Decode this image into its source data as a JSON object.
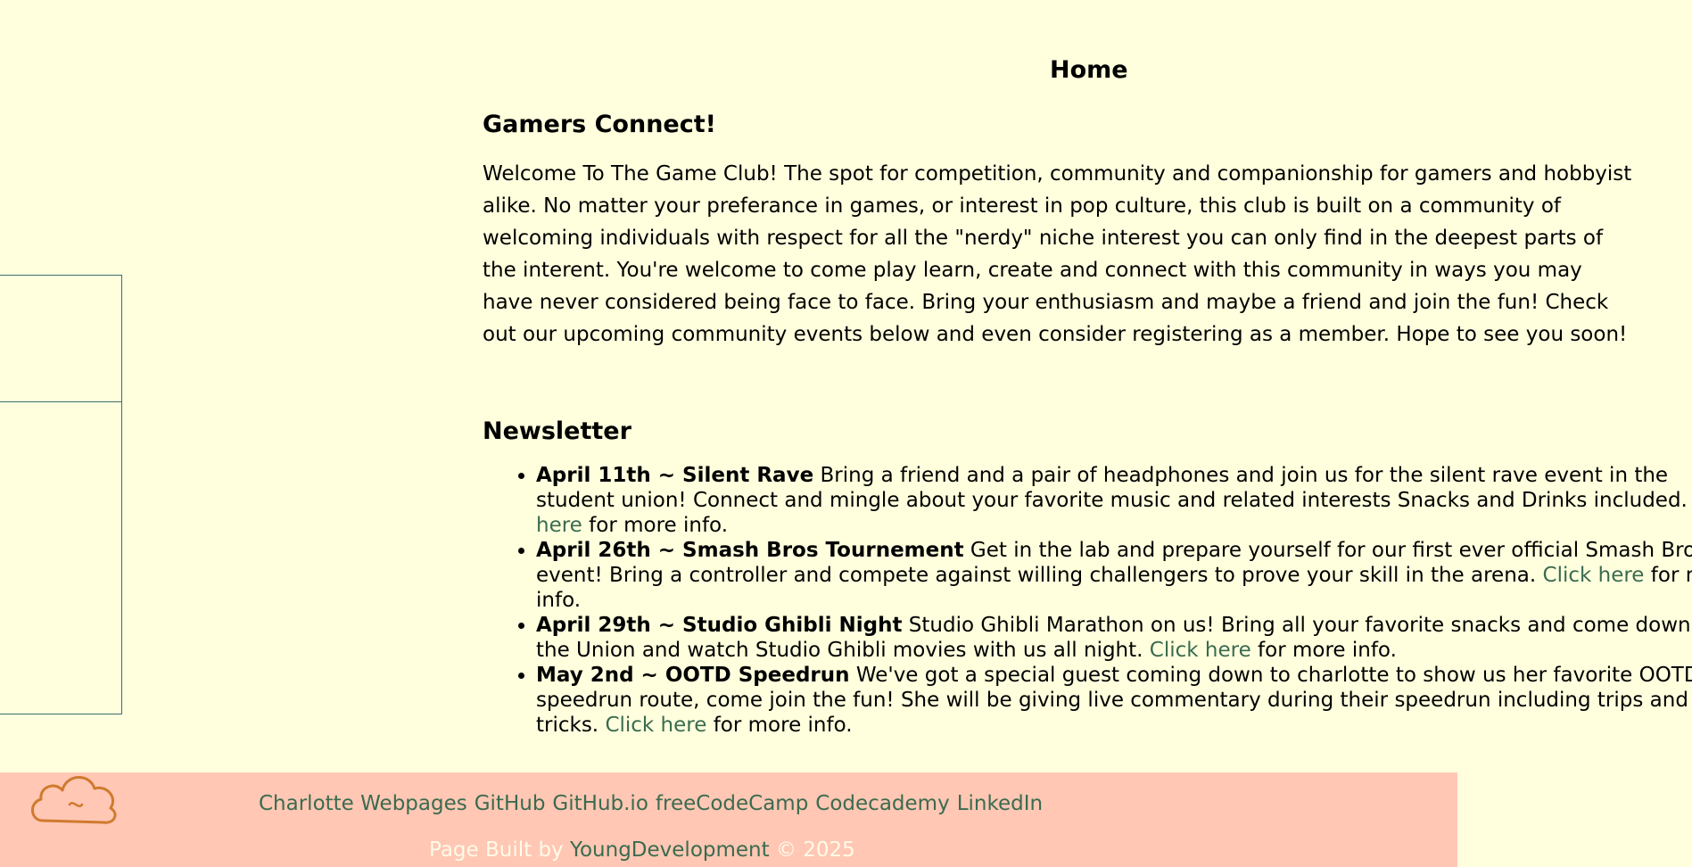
{
  "header": {
    "title": "Home"
  },
  "intro": {
    "title": "Gamers Connect!",
    "body": "Welcome To The Game Club! The spot for competition, community and companionship for gamers and hobbyist alike. No matter your preferance in games, or interest in pop culture, this club is built on a community of welcoming individuals with respect for all the \"nerdy\" niche interest you can only find in the deepest parts of the interent. You're welcome to come play learn, create and connect with this community in ways you may have never considered being face to face. Bring your enthusiasm and maybe a friend and join the fun! Check out our upcoming community events below and even consider registering as a member. Hope to see you soon!"
  },
  "newsletter": {
    "title": "Newsletter",
    "events": [
      {
        "heading": "April 11th ~ Silent Rave",
        "text": " Bring a friend and a pair of headphones and join us for the silent rave event in the student union! Connect and mingle about your favorite music and related interests Snacks and Drinks included. ",
        "link": "Click here",
        "suffix": " for more info."
      },
      {
        "heading": "April 26th ~ Smash Bros Tournement",
        "text": " Get in the lab and prepare yourself for our first ever official Smash Bros event! Bring a controller and compete against willing challengers to prove your skill in the arena. ",
        "link": "Click here",
        "suffix": " for more info."
      },
      {
        "heading": "April 29th ~ Studio Ghibli Night",
        "text": " Studio Ghibli Marathon on us! Bring all your favorite snacks and come down to the Union and watch Studio Ghibli movies with us all night. ",
        "link": "Click here",
        "suffix": " for more info."
      },
      {
        "heading": "May 2nd ~ OOTD Speedrun",
        "text": " We've got a special guest coming down to charlotte to show us her favorite OOTD speedrun route, come join the fun! She will be giving live commentary during their speedrun including trips and tricks. ",
        "link": "Click here",
        "suffix": " for more info."
      }
    ]
  },
  "footer": {
    "logo_icon": "cloud-icon",
    "links": [
      "Charlotte Webpages",
      "GitHub",
      "GitHub.io",
      "freeCodeCamp",
      "Codecademy",
      "LinkedIn"
    ],
    "credit_prefix": "Page Built by ",
    "credit_link": "YoungDevelopment",
    "credit_suffix": " © 2025"
  },
  "colors": {
    "background": "#ffffde",
    "footer_bg": "#ffc7b4",
    "link": "#3a6b4f",
    "logo": "#d07a2e"
  }
}
